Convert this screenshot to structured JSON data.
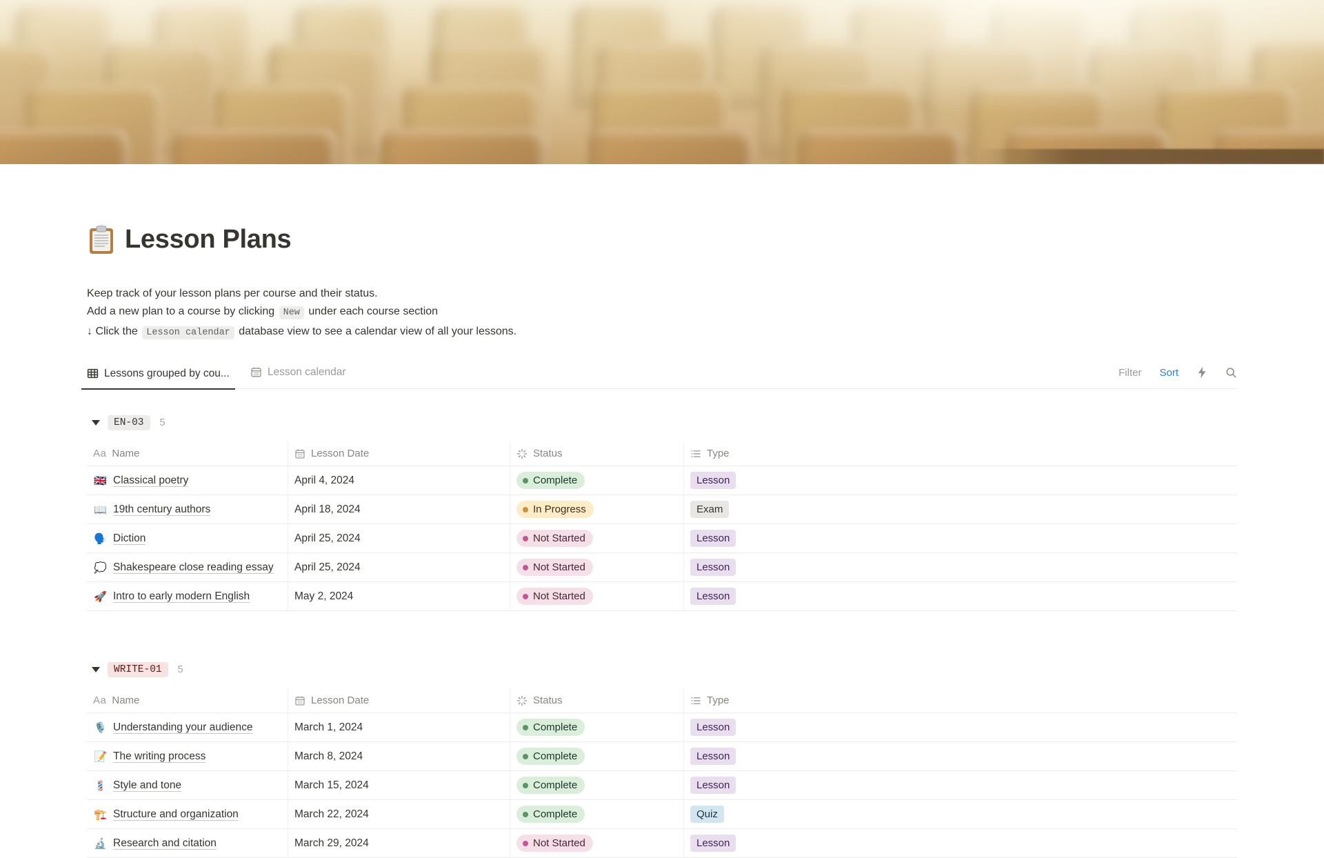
{
  "page": {
    "icon": "📋",
    "title": "Lesson Plans",
    "description_lines": [
      {
        "text": "Keep track of your lesson plans per course and their status."
      },
      {
        "before": "Add a new plan to a course by clicking ",
        "code": "New",
        "after": " under each course section"
      },
      {
        "before": "↓ Click the ",
        "code": "Lesson calendar",
        "after": " database view to see a calendar view of all your lessons."
      }
    ]
  },
  "tabs": [
    {
      "label": "Lessons grouped by cou...",
      "icon": "table-icon",
      "active": true
    },
    {
      "label": "Lesson calendar",
      "icon": "calendar-icon",
      "active": false
    }
  ],
  "toolbar": {
    "filter_label": "Filter",
    "sort_label": "Sort",
    "sort_color": "#2383E2",
    "icons": [
      "lightning-icon",
      "search-icon"
    ]
  },
  "table": {
    "columns": [
      {
        "label": "Name",
        "icon": "text-icon"
      },
      {
        "label": "Lesson Date",
        "icon": "calendar-icon"
      },
      {
        "label": "Status",
        "icon": "status-spinner-icon"
      },
      {
        "label": "Type",
        "icon": "list-icon"
      }
    ],
    "groups": [
      {
        "name": "EN-03",
        "count": "5",
        "bg": "#EDECEA",
        "color": "#37352F",
        "rows": [
          {
            "emoji": "🇬🇧",
            "name": "Classical poetry",
            "date": "April 4, 2024",
            "status": "Complete",
            "type": "Lesson"
          },
          {
            "emoji": "📖",
            "name": "19th century authors",
            "date": "April 18, 2024",
            "status": "In Progress",
            "type": "Exam"
          },
          {
            "emoji": "🗣️",
            "name": "Diction",
            "date": "April 25, 2024",
            "status": "Not Started",
            "type": "Lesson"
          },
          {
            "emoji": "💭",
            "name": "Shakespeare close reading essay",
            "date": "April 25, 2024",
            "status": "Not Started",
            "type": "Lesson"
          },
          {
            "emoji": "🚀",
            "name": "Intro to early modern English",
            "date": "May 2, 2024",
            "status": "Not Started",
            "type": "Lesson"
          }
        ]
      },
      {
        "name": "WRITE-01",
        "count": "5",
        "bg": "#F9E3E2",
        "color": "#5D1715",
        "rows": [
          {
            "emoji": "🎙️",
            "name": "Understanding your audience",
            "date": "March 1, 2024",
            "status": "Complete",
            "type": "Lesson"
          },
          {
            "emoji": "📝",
            "name": "The writing process",
            "date": "March 8, 2024",
            "status": "Complete",
            "type": "Lesson"
          },
          {
            "emoji": "💈",
            "name": "Style and tone",
            "date": "March 15, 2024",
            "status": "Complete",
            "type": "Lesson"
          },
          {
            "emoji": "🏗️",
            "name": "Structure and organization",
            "date": "March 22, 2024",
            "status": "Complete",
            "type": "Quiz"
          },
          {
            "emoji": "🔬",
            "name": "Research and citation",
            "date": "March 29, 2024",
            "status": "Not Started",
            "type": "Lesson"
          }
        ]
      }
    ]
  },
  "status_styles": {
    "Complete": {
      "bg": "#DBEDDB",
      "dot": "#5B9467",
      "text": "#1C3829"
    },
    "In Progress": {
      "bg": "#FDECC8",
      "dot": "#C9923B",
      "text": "#402C1B"
    },
    "Not Started": {
      "bg": "#F6E0E8",
      "dot": "#C15796",
      "text": "#4C2337"
    }
  },
  "type_styles": {
    "Lesson": {
      "bg": "#E8DEEE",
      "text": "#412454"
    },
    "Exam": {
      "bg": "#E8E7E4",
      "text": "#373530"
    },
    "Quiz": {
      "bg": "#D3E5EF",
      "text": "#183347"
    }
  }
}
